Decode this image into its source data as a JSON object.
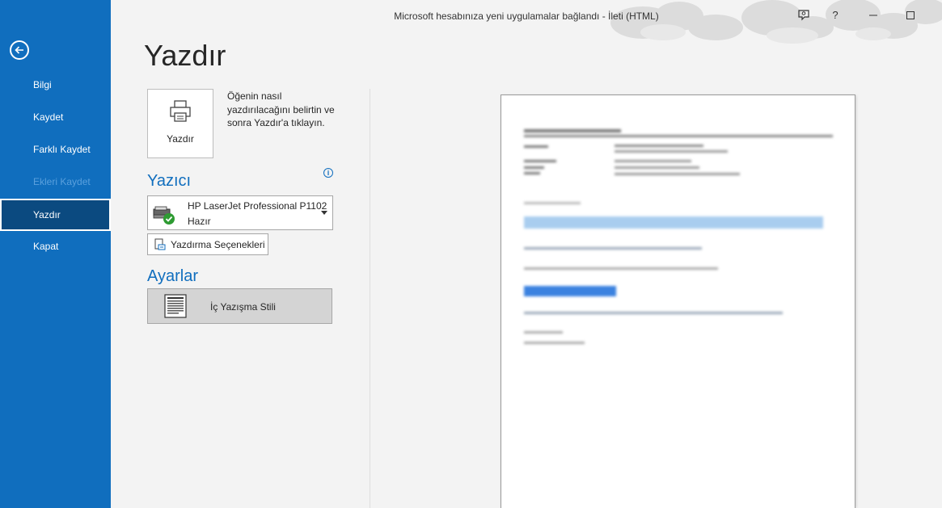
{
  "window": {
    "title": "Microsoft hesabınıza yeni uygulamalar bağlandı  -  İleti (HTML)",
    "help_label": "?"
  },
  "sidebar": {
    "items": [
      {
        "label": "Bilgi",
        "state": "normal"
      },
      {
        "label": "Kaydet",
        "state": "normal"
      },
      {
        "label": "Farklı Kaydet",
        "state": "normal"
      },
      {
        "label": "Ekleri Kaydet",
        "state": "disabled"
      },
      {
        "label": "Yazdır",
        "state": "active"
      },
      {
        "label": "Kapat",
        "state": "normal"
      }
    ]
  },
  "page": {
    "title": "Yazdır",
    "print_button_label": "Yazdır",
    "print_description": "Öğenin nasıl yazdırılacağını belirtin ve sonra Yazdır'a tıklayın."
  },
  "printer": {
    "heading": "Yazıcı",
    "info_icon": "i",
    "selected_name": "HP LaserJet Professional P1102",
    "status": "Hazır",
    "options_label": "Yazdırma Seçenekleri"
  },
  "settings": {
    "heading": "Ayarlar",
    "style_label": "İç Yazışma Stili"
  },
  "colors": {
    "sidebar": "#106ebe",
    "sidebar_active": "#0b4a80",
    "accent": "#106ebe",
    "background": "#f3f3f3"
  },
  "icons": {
    "back": "back-arrow-icon",
    "printer": "printer-icon",
    "ready": "checkmark-icon",
    "options": "print-options-icon",
    "style": "document-style-icon",
    "feedback": "feedback-icon",
    "minimize": "minimize-icon",
    "maximize": "maximize-icon"
  }
}
